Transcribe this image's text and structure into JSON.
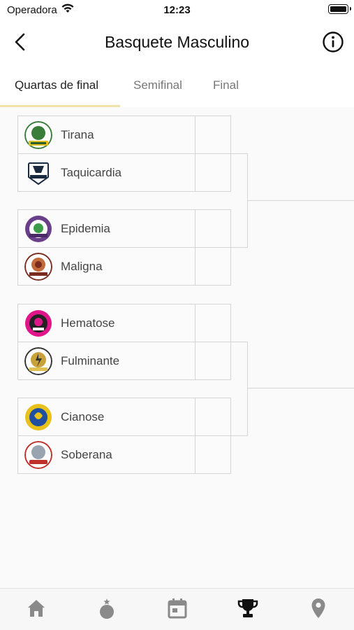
{
  "status_bar": {
    "carrier": "Operadora",
    "time": "12:23"
  },
  "header": {
    "title": "Basquete Masculino",
    "back_icon": "chevron-left-icon",
    "info_icon": "info-icon"
  },
  "tabs": [
    {
      "label": "Quartas de final",
      "active": true
    },
    {
      "label": "Semifinal",
      "active": false
    },
    {
      "label": "Final",
      "active": false
    }
  ],
  "matches": [
    {
      "home": {
        "name": "Tirana",
        "score": ""
      },
      "away": {
        "name": "Taquicardia",
        "score": ""
      }
    },
    {
      "home": {
        "name": "Epidemia",
        "score": ""
      },
      "away": {
        "name": "Maligna",
        "score": ""
      }
    },
    {
      "home": {
        "name": "Hematose",
        "score": ""
      },
      "away": {
        "name": "Fulminante",
        "score": ""
      }
    },
    {
      "home": {
        "name": "Cianose",
        "score": ""
      },
      "away": {
        "name": "Soberana",
        "score": ""
      }
    }
  ],
  "team_colors": {
    "Tirana": "#3a7d3a",
    "Taquicardia": "#1c2a40",
    "Epidemia": "#6a3f8a",
    "Maligna": "#7a2d1f",
    "Hematose": "#e0158a",
    "Fulminante": "#c8a13a",
    "Cianose": "#e8c21a",
    "Soberana": "#9aa4b0"
  },
  "bottom_nav": [
    {
      "icon": "home-icon"
    },
    {
      "icon": "medal-icon"
    },
    {
      "icon": "calendar-icon"
    },
    {
      "icon": "trophy-icon",
      "active": true
    },
    {
      "icon": "location-pin-icon"
    }
  ]
}
